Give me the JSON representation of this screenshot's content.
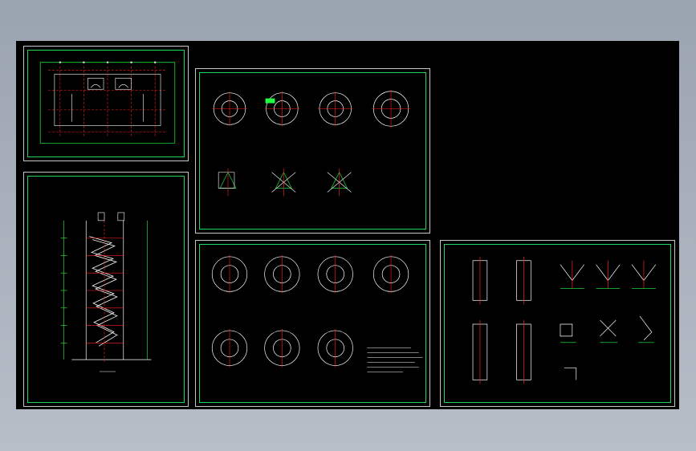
{
  "app": {
    "background_gradient": [
      "#9aa3b0",
      "#b8bec8"
    ],
    "viewport_color": "#000000"
  },
  "colors": {
    "sheet_outer": "#c8c8c8",
    "sheet_inner": "#1fd85a",
    "line_white": "#ffffff",
    "line_red": "#ff2020",
    "line_green": "#20ff40",
    "line_cyan": "#00e0ff",
    "line_yellow": "#ffff40"
  },
  "sheets": [
    {
      "id": "sheet-plan",
      "content": "floor-plan"
    },
    {
      "id": "sheet-elevation",
      "content": "stair-section"
    },
    {
      "id": "sheet-stair-plans-1",
      "content": "spiral-stair-plans"
    },
    {
      "id": "sheet-stair-plans-2",
      "content": "spiral-stair-plans-notes"
    },
    {
      "id": "sheet-details",
      "content": "connection-details"
    }
  ]
}
